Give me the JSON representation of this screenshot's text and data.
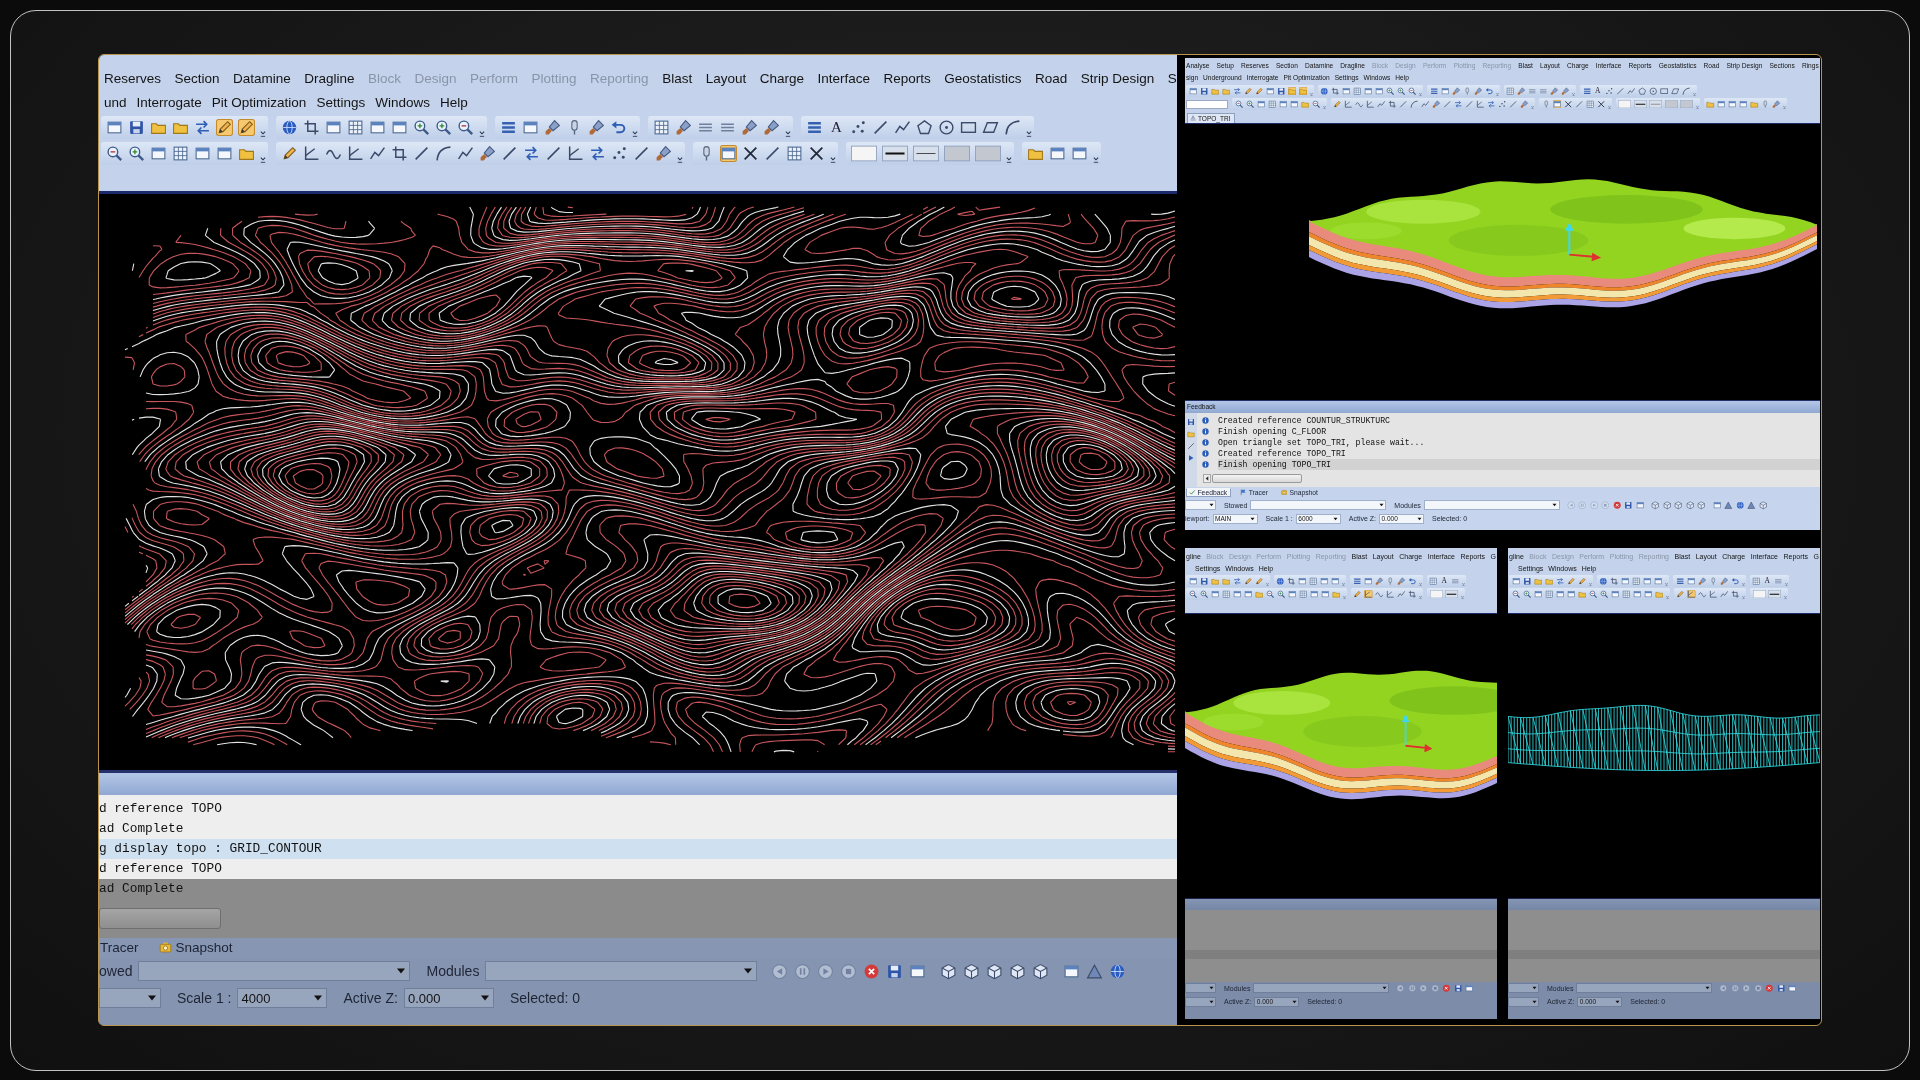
{
  "windows": [
    {
      "menu_rows": [
        [
          {
            "label": "Reserves",
            "disabled": false
          },
          {
            "label": "Section",
            "disabled": false
          },
          {
            "label": "Datamine",
            "disabled": false
          },
          {
            "label": "Dragline",
            "disabled": false
          },
          {
            "label": "Block",
            "disabled": true
          },
          {
            "label": "Design",
            "disabled": true
          },
          {
            "label": "Perform",
            "disabled": true
          },
          {
            "label": "Plotting",
            "disabled": true
          },
          {
            "label": "Reporting",
            "disabled": true
          },
          {
            "label": "Blast",
            "disabled": false
          },
          {
            "label": "Layout",
            "disabled": false
          },
          {
            "label": "Charge",
            "disabled": false
          },
          {
            "label": "Interface",
            "disabled": false
          },
          {
            "label": "Reports",
            "disabled": false
          },
          {
            "label": "Geostatistics",
            "disabled": false
          },
          {
            "label": "Road",
            "disabled": false
          },
          {
            "label": "Strip Design",
            "disabled": false
          },
          {
            "label": "S",
            "disabled": false
          }
        ],
        [
          {
            "label": "und",
            "disabled": false
          },
          {
            "label": "Interrogate",
            "disabled": false
          },
          {
            "label": "Pit Optimization",
            "disabled": false
          },
          {
            "label": "Settings",
            "disabled": false
          },
          {
            "label": "Windows",
            "disabled": false
          },
          {
            "label": "Help",
            "disabled": false
          }
        ]
      ],
      "toolbar_rows": [
        [
          {
            "kind": "buttons",
            "buttons": [
              {
                "on": false
              },
              {
                "on": false
              },
              {
                "on": false
              },
              {
                "on": false
              },
              {
                "on": false
              },
              {
                "on": true
              },
              {
                "on": true
              }
            ]
          },
          {
            "kind": "buttons",
            "buttons": [
              {
                "on": false
              },
              {
                "on": false
              },
              {
                "on": false
              },
              {
                "on": false
              },
              {
                "on": false
              },
              {
                "on": false
              },
              {
                "on": false
              },
              {
                "on": false
              },
              {
                "on": false
              }
            ]
          },
          {
            "kind": "buttons",
            "buttons": [
              {
                "on": false
              },
              {
                "on": false
              },
              {
                "on": false
              },
              {
                "on": false
              },
              {
                "on": false
              },
              {
                "on": false
              }
            ]
          },
          {
            "kind": "buttons",
            "buttons": [
              {
                "on": false
              },
              {
                "on": false
              },
              {
                "on": false
              },
              {
                "on": false
              },
              {
                "on": false
              },
              {
                "on": false
              }
            ]
          },
          {
            "kind": "buttons",
            "buttons": [
              {
                "on": false
              },
              {
                "on": false,
                "label": "A"
              },
              {
                "on": false
              },
              {
                "on": false
              },
              {
                "on": false
              },
              {
                "on": false
              },
              {
                "on": false
              },
              {
                "on": false
              },
              {
                "on": false
              },
              {
                "on": false
              }
            ]
          }
        ],
        [
          {
            "kind": "buttons",
            "buttons": [
              {
                "on": false
              },
              {
                "on": false
              },
              {
                "on": false
              },
              {
                "on": false
              },
              {
                "on": false
              },
              {
                "on": false
              },
              {
                "on": false
              }
            ]
          },
          {
            "kind": "buttons",
            "buttons": [
              {
                "on": false
              },
              {
                "on": false
              },
              {
                "on": false
              },
              {
                "on": false
              },
              {
                "on": false
              },
              {
                "on": false
              },
              {
                "on": false
              },
              {
                "on": false
              },
              {
                "on": false
              },
              {
                "on": false
              },
              {
                "on": false
              },
              {
                "on": false
              },
              {
                "on": false
              },
              {
                "on": false
              },
              {
                "on": false
              },
              {
                "on": false
              },
              {
                "on": false
              },
              {
                "on": false
              }
            ]
          },
          {
            "kind": "buttons",
            "buttons": [
              {
                "on": false
              },
              {
                "on": true
              },
              {
                "on": false
              },
              {
                "on": false
              },
              {
                "on": false
              },
              {
                "on": false
              }
            ]
          },
          {
            "kind": "styles",
            "buttons": [
              {
                "on": false
              },
              {
                "on": false
              },
              {
                "on": false
              },
              {
                "on": false
              },
              {
                "on": false
              }
            ]
          },
          {
            "kind": "buttons",
            "buttons": [
              {
                "on": false
              },
              {
                "on": false
              },
              {
                "on": false
              }
            ]
          }
        ]
      ],
      "viewport": {
        "kind": "contour"
      },
      "feedback": {
        "lines": [
          {
            "text": "d reference TOPO",
            "selected": false
          },
          {
            "text": "ad Complete",
            "selected": false
          },
          {
            "text": "g display topo : GRID_CONTOUR",
            "selected": true
          },
          {
            "text": "d reference TOPO",
            "selected": false
          },
          {
            "text": "ad Complete",
            "selected": false
          }
        ]
      },
      "dock_tabs": [
        {
          "label": "Tracer",
          "selected": false
        },
        {
          "label": "Snapshot",
          "selected": false,
          "kind": "snapshot"
        }
      ],
      "status_rows": [
        [
          {
            "kind": "label",
            "text": "owed"
          },
          {
            "kind": "field"
          },
          {
            "kind": "label",
            "text": "Modules"
          },
          {
            "kind": "field"
          },
          {
            "kind": "icons",
            "buttons": [
              {
                "disabled": true
              },
              {
                "disabled": true
              },
              {
                "disabled": true
              },
              {
                "disabled": true
              },
              {
                "disabled": false
              },
              {
                "disabled": false
              },
              {
                "disabled": false
              }
            ]
          },
          {
            "kind": "icons",
            "buttons": [
              {
                "disabled": false
              },
              {
                "disabled": false
              },
              {
                "disabled": false
              },
              {
                "disabled": false
              },
              {
                "disabled": false
              }
            ]
          },
          {
            "kind": "icons",
            "buttons": [
              {
                "disabled": false
              },
              {
                "disabled": false
              },
              {
                "disabled": false
              }
            ]
          }
        ],
        [
          {
            "kind": "field"
          },
          {
            "kind": "label",
            "text": "Scale 1 :"
          },
          {
            "kind": "field",
            "value": "4000"
          },
          {
            "kind": "label",
            "text": "Active Z:"
          },
          {
            "kind": "field",
            "value": "0.000"
          },
          {
            "kind": "label",
            "text": "Selected: 0"
          }
        ]
      ]
    },
    {
      "menu_rows": [
        [
          {
            "label": "Analyse",
            "disabled": false
          },
          {
            "label": "Setup",
            "disabled": false
          },
          {
            "label": "Reserves",
            "disabled": false
          },
          {
            "label": "Section",
            "disabled": false
          },
          {
            "label": "Datamine",
            "disabled": false
          },
          {
            "label": "Dragline",
            "disabled": false
          },
          {
            "label": "Block",
            "disabled": true
          },
          {
            "label": "Design",
            "disabled": true
          },
          {
            "label": "Perform",
            "disabled": true
          },
          {
            "label": "Plotting",
            "disabled": true
          },
          {
            "label": "Reporting",
            "disabled": true
          },
          {
            "label": "Blast",
            "disabled": false
          },
          {
            "label": "Layout",
            "disabled": false
          },
          {
            "label": "Charge",
            "disabled": false
          },
          {
            "label": "Interface",
            "disabled": false
          },
          {
            "label": "Reports",
            "disabled": false
          },
          {
            "label": "Geostatistics",
            "disabled": false
          },
          {
            "label": "Road",
            "disabled": false
          },
          {
            "label": "Strip Design",
            "disabled": false
          },
          {
            "label": "Sections",
            "disabled": false
          },
          {
            "label": "Rings",
            "disabled": false
          }
        ],
        [
          {
            "label": "sign",
            "disabled": false
          },
          {
            "label": "Underground",
            "disabled": false
          },
          {
            "label": "Interrogate",
            "disabled": false
          },
          {
            "label": "Pit Optimization",
            "disabled": false
          },
          {
            "label": "Settings",
            "disabled": false
          },
          {
            "label": "Windows",
            "disabled": false
          },
          {
            "label": "Help",
            "disabled": false
          }
        ]
      ],
      "toolbar_rows": [
        [
          {
            "kind": "buttons",
            "buttons": [
              {
                "on": false
              },
              {
                "on": false
              },
              {
                "on": false
              },
              {
                "on": false
              },
              {
                "on": false
              },
              {
                "on": false
              },
              {
                "on": false
              },
              {
                "on": false
              },
              {
                "on": false
              },
              {
                "on": true
              },
              {
                "on": true
              }
            ]
          },
          {
            "kind": "buttons",
            "buttons": [
              {
                "on": false
              },
              {
                "on": false
              },
              {
                "on": false
              },
              {
                "on": false
              },
              {
                "on": false
              },
              {
                "on": false
              },
              {
                "on": false
              },
              {
                "on": false
              },
              {
                "on": false
              }
            ]
          },
          {
            "kind": "buttons",
            "buttons": [
              {
                "on": false
              },
              {
                "on": false
              },
              {
                "on": false
              },
              {
                "on": false
              },
              {
                "on": false
              },
              {
                "on": false
              }
            ]
          },
          {
            "kind": "buttons",
            "buttons": [
              {
                "on": false
              },
              {
                "on": false
              },
              {
                "on": false
              },
              {
                "on": false
              },
              {
                "on": false
              },
              {
                "on": false
              }
            ]
          },
          {
            "kind": "buttons",
            "buttons": [
              {
                "on": false
              },
              {
                "on": false,
                "label": "A"
              },
              {
                "on": false
              },
              {
                "on": false
              },
              {
                "on": false
              },
              {
                "on": false
              },
              {
                "on": false
              },
              {
                "on": false
              },
              {
                "on": false
              },
              {
                "on": false
              }
            ]
          }
        ],
        [
          {
            "kind": "field"
          },
          {
            "kind": "buttons",
            "buttons": [
              {
                "on": false
              },
              {
                "on": false
              },
              {
                "on": false
              },
              {
                "on": false
              },
              {
                "on": false
              },
              {
                "on": false
              },
              {
                "on": false
              },
              {
                "on": false
              }
            ]
          },
          {
            "kind": "buttons",
            "buttons": [
              {
                "on": false
              },
              {
                "on": false
              },
              {
                "on": false
              },
              {
                "on": false
              },
              {
                "on": false
              },
              {
                "on": false
              },
              {
                "on": false
              },
              {
                "on": false
              },
              {
                "on": false
              },
              {
                "on": false
              },
              {
                "on": false
              },
              {
                "on": false
              },
              {
                "on": false
              },
              {
                "on": false
              },
              {
                "on": false
              },
              {
                "on": false
              },
              {
                "on": false
              },
              {
                "on": false
              }
            ]
          },
          {
            "kind": "buttons",
            "buttons": [
              {
                "on": false
              },
              {
                "on": true
              },
              {
                "on": false
              },
              {
                "on": false
              },
              {
                "on": false
              },
              {
                "on": false
              }
            ]
          },
          {
            "kind": "styles",
            "buttons": [
              {
                "on": false
              },
              {
                "on": false
              },
              {
                "on": false
              },
              {
                "on": false
              },
              {
                "on": false
              }
            ]
          },
          {
            "kind": "buttons",
            "buttons": [
              {
                "on": false
              },
              {
                "on": false
              },
              {
                "on": false
              },
              {
                "on": false
              },
              {
                "on": false
              },
              {
                "on": false
              },
              {
                "on": false
              }
            ]
          }
        ]
      ],
      "document_tab": "TOPO_TRI",
      "viewport": {
        "kind": "terrain"
      },
      "feedback": {
        "title": "Feedback",
        "lines": [
          {
            "text": "Created reference COUNTUR_STRUKTURC",
            "selected": false,
            "kind": "info"
          },
          {
            "text": "Finish opening C_FLOOR",
            "selected": false,
            "kind": "info"
          },
          {
            "text": "Open triangle set TOPO_TRI, please wait...",
            "selected": false,
            "kind": "info"
          },
          {
            "text": "Created reference TOPO_TRI",
            "selected": false,
            "kind": "info"
          },
          {
            "text": "Finish opening TOPO_TRI",
            "selected": true,
            "kind": "info"
          }
        ]
      },
      "dock_tabs": [
        {
          "label": "Feedback",
          "selected": true,
          "kind": "feedback"
        },
        {
          "label": "Tracer",
          "selected": false,
          "kind": "tracer"
        },
        {
          "label": "Snapshot",
          "selected": false,
          "kind": "snapshot"
        }
      ],
      "status_rows": [
        [
          {
            "kind": "field"
          },
          {
            "kind": "label",
            "text": "Stowed"
          },
          {
            "kind": "field"
          },
          {
            "kind": "label",
            "text": "Modules"
          },
          {
            "kind": "field"
          },
          {
            "kind": "icons",
            "buttons": [
              {
                "disabled": true
              },
              {
                "disabled": true
              },
              {
                "disabled": true
              },
              {
                "disabled": true
              },
              {
                "disabled": false
              },
              {
                "disabled": false
              },
              {
                "disabled": false
              }
            ]
          },
          {
            "kind": "icons",
            "buttons": [
              {
                "disabled": false
              },
              {
                "disabled": false
              },
              {
                "disabled": false
              },
              {
                "disabled": false
              },
              {
                "disabled": false
              }
            ]
          },
          {
            "kind": "icons",
            "buttons": [
              {
                "disabled": false
              },
              {
                "disabled": false
              },
              {
                "disabled": false
              },
              {
                "disabled": false
              },
              {
                "disabled": false
              }
            ]
          }
        ],
        [
          {
            "kind": "label",
            "text": "iewport:"
          },
          {
            "kind": "field",
            "value": "MAIN"
          },
          {
            "kind": "label",
            "text": "Scale 1 :"
          },
          {
            "kind": "field",
            "value": "6000"
          },
          {
            "kind": "label",
            "text": "Active Z:"
          },
          {
            "kind": "field",
            "value": "0.000"
          },
          {
            "kind": "label",
            "text": "Selected: 0"
          }
        ]
      ]
    },
    {
      "menu_rows": [
        [
          {
            "label": "gline",
            "disabled": false
          },
          {
            "label": "Block",
            "disabled": true
          },
          {
            "label": "Design",
            "disabled": true
          },
          {
            "label": "Perform",
            "disabled": true
          },
          {
            "label": "Plotting",
            "disabled": true
          },
          {
            "label": "Reporting",
            "disabled": true
          },
          {
            "label": "Blast",
            "disabled": false
          },
          {
            "label": "Layout",
            "disabled": false
          },
          {
            "label": "Charge",
            "disabled": false
          },
          {
            "label": "Interface",
            "disabled": false
          },
          {
            "label": "Reports",
            "disabled": false
          },
          {
            "label": "G",
            "disabled": false
          }
        ],
        [
          {
            "label": "Settings",
            "disabled": false
          },
          {
            "label": "Windows",
            "disabled": false
          },
          {
            "label": "Help",
            "disabled": false
          }
        ]
      ],
      "toolbar_rows": [
        [
          {
            "kind": "buttons",
            "buttons": [
              {
                "on": false
              },
              {
                "on": false
              },
              {
                "on": false
              },
              {
                "on": false
              },
              {
                "on": false
              },
              {
                "on": false
              },
              {
                "on": false
              }
            ]
          },
          {
            "kind": "buttons",
            "buttons": [
              {
                "on": false
              },
              {
                "on": false
              },
              {
                "on": false
              },
              {
                "on": false
              },
              {
                "on": false
              },
              {
                "on": false
              }
            ]
          },
          {
            "kind": "buttons",
            "buttons": [
              {
                "on": false
              },
              {
                "on": false
              },
              {
                "on": false
              },
              {
                "on": false
              },
              {
                "on": false
              },
              {
                "on": false
              }
            ]
          },
          {
            "kind": "buttons",
            "buttons": [
              {
                "on": false
              },
              {
                "on": false,
                "label": "A"
              },
              {
                "on": false
              }
            ]
          }
        ],
        [
          {
            "kind": "buttons",
            "buttons": [
              {
                "on": false
              },
              {
                "on": false
              },
              {
                "on": false
              },
              {
                "on": false
              },
              {
                "on": false
              },
              {
                "on": false
              },
              {
                "on": false
              },
              {
                "on": false
              },
              {
                "on": false
              },
              {
                "on": false
              },
              {
                "on": false
              },
              {
                "on": false
              },
              {
                "on": false
              },
              {
                "on": false
              }
            ]
          },
          {
            "kind": "buttons",
            "buttons": [
              {
                "on": false
              },
              {
                "on": true
              },
              {
                "on": false
              },
              {
                "on": false
              },
              {
                "on": false
              },
              {
                "on": false
              }
            ]
          },
          {
            "kind": "styles",
            "buttons": [
              {
                "on": false
              },
              {
                "on": false
              }
            ]
          }
        ]
      ],
      "viewport": {
        "kind": "terrain"
      },
      "status_rows": [
        [
          {
            "kind": "field"
          },
          {
            "kind": "label",
            "text": "Modules"
          },
          {
            "kind": "field"
          },
          {
            "kind": "icons",
            "buttons": [
              {
                "disabled": true
              },
              {
                "disabled": true
              },
              {
                "disabled": true
              },
              {
                "disabled": true
              },
              {
                "disabled": false
              },
              {
                "disabled": false
              },
              {
                "disabled": false
              }
            ]
          }
        ],
        [
          {
            "kind": "field"
          },
          {
            "kind": "label",
            "text": "Active Z:"
          },
          {
            "kind": "field",
            "value": "0.000"
          },
          {
            "kind": "label",
            "text": "Selected: 0"
          }
        ]
      ]
    },
    {
      "menu_rows": [
        [
          {
            "label": "gline",
            "disabled": false
          },
          {
            "label": "Block",
            "disabled": true
          },
          {
            "label": "Design",
            "disabled": true
          },
          {
            "label": "Perform",
            "disabled": true
          },
          {
            "label": "Plotting",
            "disabled": true
          },
          {
            "label": "Reporting",
            "disabled": true
          },
          {
            "label": "Blast",
            "disabled": false
          },
          {
            "label": "Layout",
            "disabled": false
          },
          {
            "label": "Charge",
            "disabled": false
          },
          {
            "label": "Interface",
            "disabled": false
          },
          {
            "label": "Reports",
            "disabled": false
          },
          {
            "label": "G",
            "disabled": false
          }
        ],
        [
          {
            "label": "Settings",
            "disabled": false
          },
          {
            "label": "Windows",
            "disabled": false
          },
          {
            "label": "Help",
            "disabled": false
          }
        ]
      ],
      "toolbar_rows": [
        [
          {
            "kind": "buttons",
            "buttons": [
              {
                "on": false
              },
              {
                "on": false
              },
              {
                "on": false
              },
              {
                "on": false
              },
              {
                "on": false
              },
              {
                "on": false
              },
              {
                "on": false
              }
            ]
          },
          {
            "kind": "buttons",
            "buttons": [
              {
                "on": false
              },
              {
                "on": false
              },
              {
                "on": false
              },
              {
                "on": false
              },
              {
                "on": false
              },
              {
                "on": false
              }
            ]
          },
          {
            "kind": "buttons",
            "buttons": [
              {
                "on": false
              },
              {
                "on": false
              },
              {
                "on": false
              },
              {
                "on": false
              },
              {
                "on": false
              },
              {
                "on": false
              }
            ]
          },
          {
            "kind": "buttons",
            "buttons": [
              {
                "on": false
              },
              {
                "on": false,
                "label": "A"
              },
              {
                "on": false
              }
            ]
          }
        ],
        [
          {
            "kind": "buttons",
            "buttons": [
              {
                "on": false
              },
              {
                "on": false
              },
              {
                "on": false
              },
              {
                "on": false
              },
              {
                "on": false
              },
              {
                "on": false
              },
              {
                "on": false
              },
              {
                "on": false
              },
              {
                "on": false
              },
              {
                "on": false
              },
              {
                "on": false
              },
              {
                "on": false
              },
              {
                "on": false
              },
              {
                "on": false
              }
            ]
          },
          {
            "kind": "buttons",
            "buttons": [
              {
                "on": false
              },
              {
                "on": true
              },
              {
                "on": false
              },
              {
                "on": false
              },
              {
                "on": false
              },
              {
                "on": false
              }
            ]
          },
          {
            "kind": "styles",
            "buttons": [
              {
                "on": false
              },
              {
                "on": false
              }
            ]
          }
        ]
      ],
      "viewport": {
        "kind": "wireframe"
      },
      "status_rows": [
        [
          {
            "kind": "field"
          },
          {
            "kind": "label",
            "text": "Modules"
          },
          {
            "kind": "field"
          },
          {
            "kind": "icons",
            "buttons": [
              {
                "disabled": true
              },
              {
                "disabled": true
              },
              {
                "disabled": true
              },
              {
                "disabled": true
              },
              {
                "disabled": false
              },
              {
                "disabled": false
              },
              {
                "disabled": false
              }
            ]
          }
        ],
        [
          {
            "kind": "field"
          },
          {
            "kind": "label",
            "text": "Active Z:"
          },
          {
            "kind": "field",
            "value": "0.000"
          },
          {
            "kind": "label",
            "text": "Selected: 0"
          }
        ]
      ]
    }
  ]
}
